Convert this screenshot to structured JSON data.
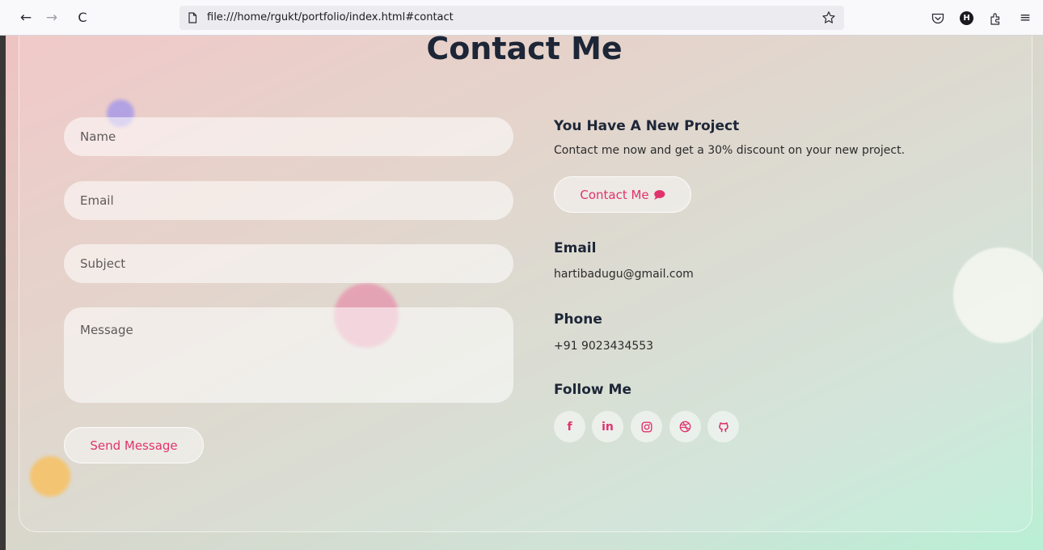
{
  "browser": {
    "back_glyph": "←",
    "forward_glyph": "→",
    "reload_glyph": "C",
    "url": "file:///home/rgukt/portfolio/index.html#contact",
    "menu_glyph": "≡",
    "account_initial": "H"
  },
  "page": {
    "title": "Contact Me"
  },
  "form": {
    "name_placeholder": "Name",
    "email_placeholder": "Email",
    "subject_placeholder": "Subject",
    "message_placeholder": "Message",
    "submit_label": "Send Message"
  },
  "info": {
    "project_heading": "You Have A New Project",
    "project_text": "Contact me now and get a 30% discount on your new project.",
    "contact_button_label": "Contact Me",
    "email_heading": "Email",
    "email_value": "hartibadugu@gmail.com",
    "phone_heading": "Phone",
    "phone_value": "+91 9023434553",
    "follow_heading": "Follow Me"
  },
  "social": {
    "facebook": "f",
    "linkedin": "in"
  },
  "colors": {
    "accent": "#e0336e",
    "heading": "#1d2637"
  }
}
